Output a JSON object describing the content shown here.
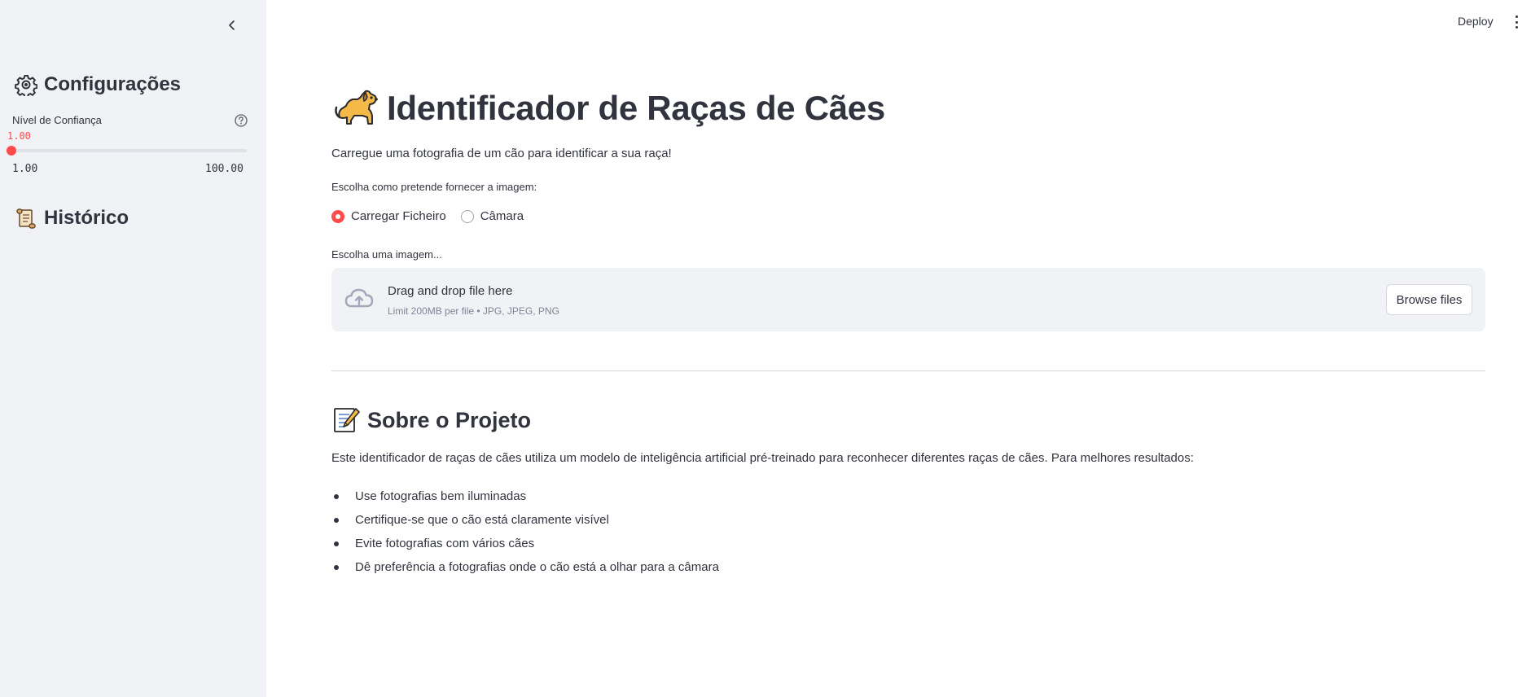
{
  "sidebar": {
    "settings_title": "Configurações",
    "settings_icon": "gear-icon",
    "slider": {
      "label": "Nível de Confiança",
      "value": "1.00",
      "min": "1.00",
      "max": "100.00",
      "level": 0.0
    },
    "history_title": "Histórico",
    "history_icon": "scroll-icon"
  },
  "header": {
    "deploy_label": "Deploy"
  },
  "main": {
    "title": "Identificador de Raças de Cães",
    "title_icon": "dog-emoji",
    "subtitle": "Carregue uma fotografia de um cão para identificar a sua raça!",
    "radio_label": "Escolha como pretende fornecer a imagem:",
    "radio_options": [
      "Carregar Ficheiro",
      "Câmara"
    ],
    "radio_selected": "Carregar Ficheiro",
    "uploader": {
      "label": "Escolha uma imagem...",
      "title": "Drag and drop file here",
      "limit": "Limit 200MB per file • JPG, JPEG, PNG",
      "button": "Browse files"
    },
    "about": {
      "title": "Sobre o Projeto",
      "title_icon": "memo-emoji",
      "text": "Este identificador de raças de cães utiliza um modelo de inteligência artificial pré-treinado para reconhecer diferentes raças de cães. Para melhores resultados:",
      "tips": [
        "Use fotografias bem iluminadas",
        "Certifique-se que o cão está claramente visível",
        "Evite fotografias com vários cães",
        "Dê preferência a fotografias onde o cão está a olhar para a câmara"
      ]
    }
  },
  "colors": {
    "accent": "#ff4b4b",
    "sidebar_bg": "#f0f2f6",
    "text": "#31333f"
  }
}
